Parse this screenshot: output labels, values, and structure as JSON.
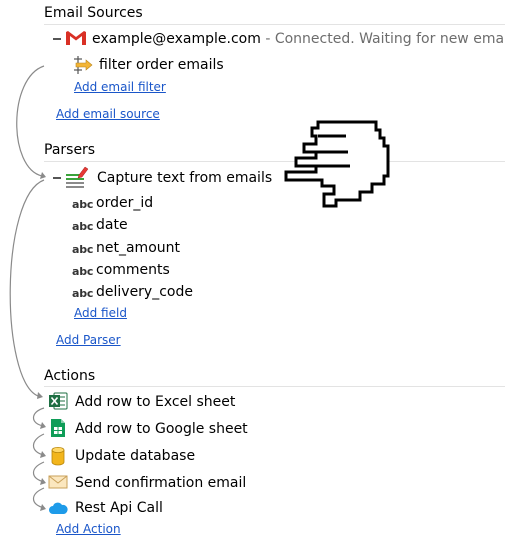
{
  "email_sources": {
    "title": "Email Sources",
    "account": {
      "address": "example@example.com",
      "status": " - Connected. Waiting for new emails.",
      "icon": "gmail-icon"
    },
    "filter": {
      "label": "filter order emails",
      "icon": "filter-icon"
    },
    "add_filter_link": "Add email filter",
    "add_source_link": "Add email source"
  },
  "parsers": {
    "title": "Parsers",
    "parser": {
      "label": "Capture text from emails",
      "icon": "text-parser-icon"
    },
    "field_type_label": "abc",
    "fields": [
      "order_id",
      "date",
      "net_amount",
      "comments",
      "delivery_code"
    ],
    "add_field_link": "Add field",
    "add_parser_link": "Add Parser"
  },
  "actions": {
    "title": "Actions",
    "items": [
      {
        "label": "Add row to Excel sheet",
        "icon": "excel-icon"
      },
      {
        "label": "Add row to Google sheet",
        "icon": "google-sheets-icon"
      },
      {
        "label": "Update database",
        "icon": "database-icon"
      },
      {
        "label": "Send confirmation email",
        "icon": "envelope-icon"
      },
      {
        "label": "Rest Api Call",
        "icon": "cloud-icon"
      }
    ],
    "add_action_link": "Add Action"
  },
  "colors": {
    "link": "#1a56c9",
    "gmail_red": "#d93025",
    "excel_green": "#1d6f42",
    "sheets_green": "#0f9d58",
    "database_yellow": "#f2b51c",
    "cloud_blue": "#1e9be9"
  },
  "cursor_icon": "pointing-hand-cursor-icon"
}
